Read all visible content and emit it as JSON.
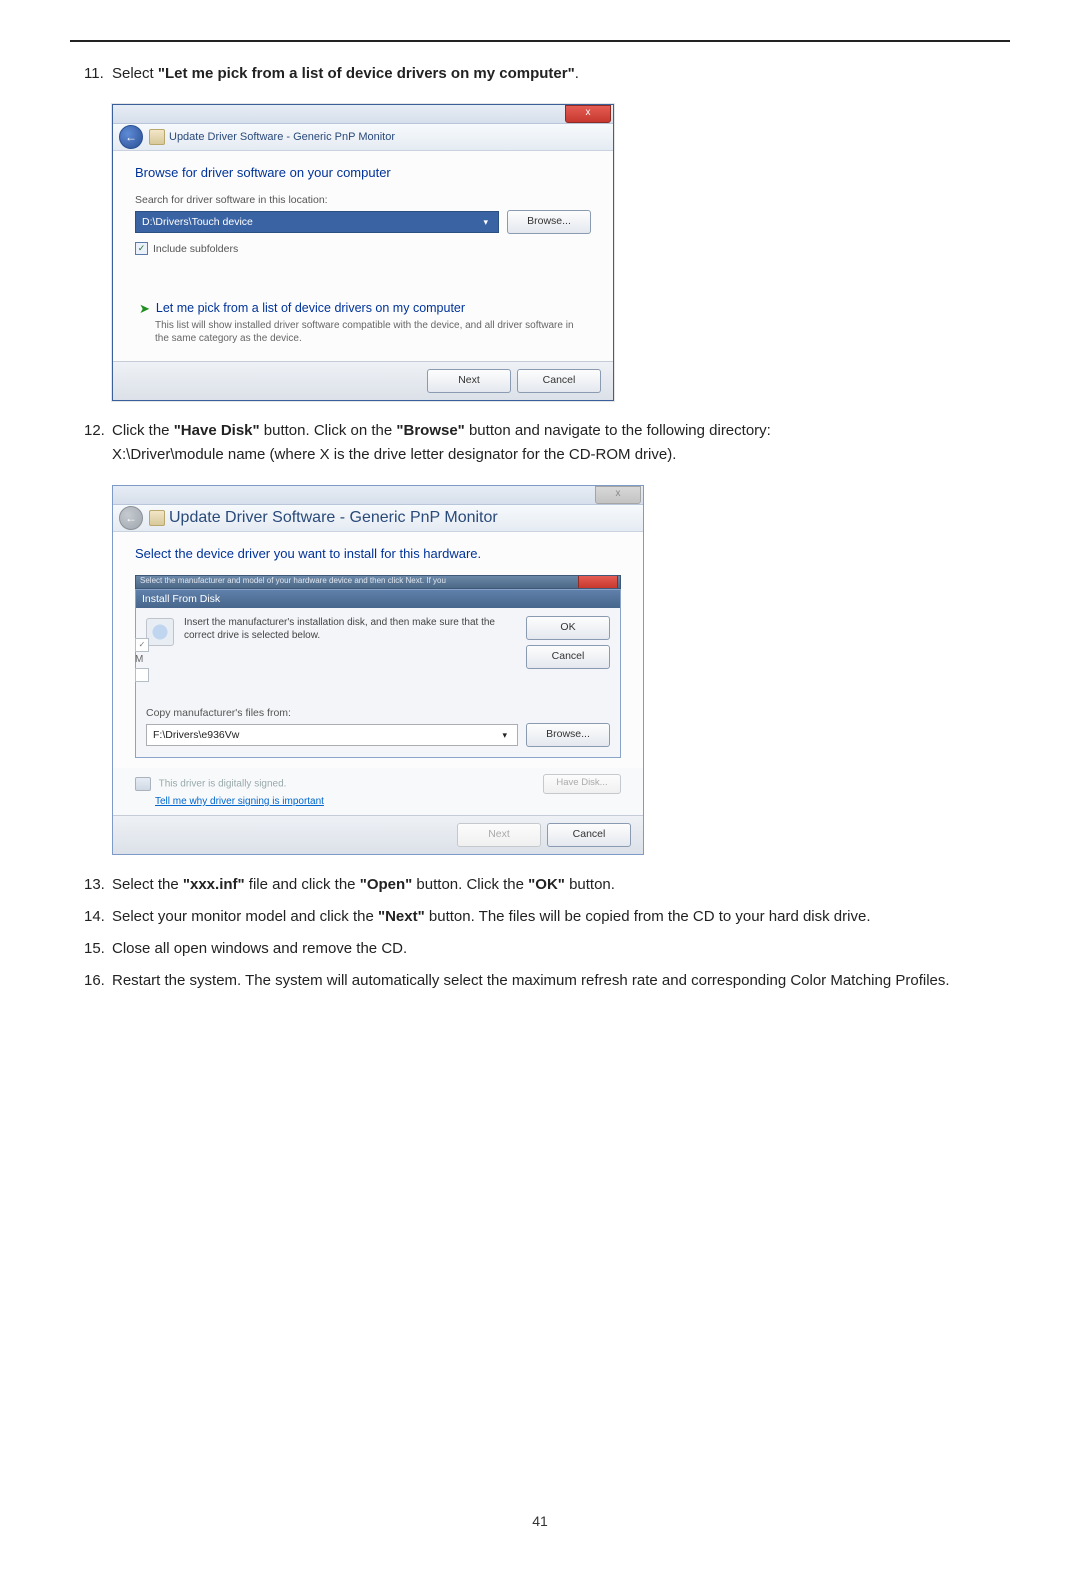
{
  "steps": {
    "s11": {
      "num": "11.",
      "prefix": "Select ",
      "bold": "\"Let me pick from a list of device drivers on my computer\"",
      "suffix": "."
    },
    "s12": {
      "num": "12.",
      "line1_pre": "Click the ",
      "line1_b1": "\"Have Disk\"",
      "line1_mid": " button. Click on the ",
      "line1_b2": "\"Browse\"",
      "line1_post": " button and navigate to the following directory:",
      "line2": "X:\\Driver\\module name (where X is the drive letter designator for the CD-ROM drive)."
    },
    "s13": {
      "num": "13.",
      "pre": "Select the ",
      "b1": "\"xxx.inf\"",
      "mid1": " file and click the ",
      "b2": "\"Open\"",
      "mid2": " button. Click the ",
      "b3": "\"OK\"",
      "post": " button."
    },
    "s14": {
      "num": "14.",
      "pre": "Select your monitor model and click the ",
      "b1": "\"Next\"",
      "post": " button. The files will be copied from the CD to your hard disk drive."
    },
    "s15": {
      "num": "15.",
      "text": "Close all open windows and remove the CD."
    },
    "s16": {
      "num": "16.",
      "text": "Restart the system. The system will automatically select the maximum refresh rate and corresponding Color Matching Profiles."
    }
  },
  "shot1": {
    "close_x": "x",
    "breadcrumb": "Update Driver Software - Generic PnP Monitor",
    "heading": "Browse for driver software on your computer",
    "search_label": "Search for driver software in this location:",
    "path_value": "D:\\Drivers\\Touch device",
    "browse_btn": "Browse...",
    "include_subfolders": "Include subfolders",
    "pick_title": "Let me pick from a list of device drivers on my computer",
    "pick_desc": "This list will show installed driver software compatible with the device, and all driver software in the same category as the device.",
    "next_btn": "Next",
    "cancel_btn": "Cancel"
  },
  "shot2": {
    "close_x": "x",
    "breadcrumb": "Update Driver Software - Generic PnP Monitor",
    "heading": "Select the device driver you want to install for this hardware.",
    "dim_text": "Select the manufacturer and model of your hardware device and then click Next. If you",
    "ifd_title": "Install From Disk",
    "ifd_text": "Insert the manufacturer's installation disk, and then make sure that the correct drive is selected below.",
    "ok_btn": "OK",
    "cancel_btn_small": "Cancel",
    "copy_label": "Copy manufacturer's files from:",
    "path_value": "F:\\Drivers\\e936Vw",
    "browse_btn": "Browse...",
    "signed_text": "This driver is digitally signed.",
    "have_disk_btn": "Have Disk...",
    "tell_me": "Tell me why driver signing is important",
    "next_btn": "Next",
    "cancel_btn": "Cancel",
    "letters_m": "M"
  },
  "page_number": "41"
}
